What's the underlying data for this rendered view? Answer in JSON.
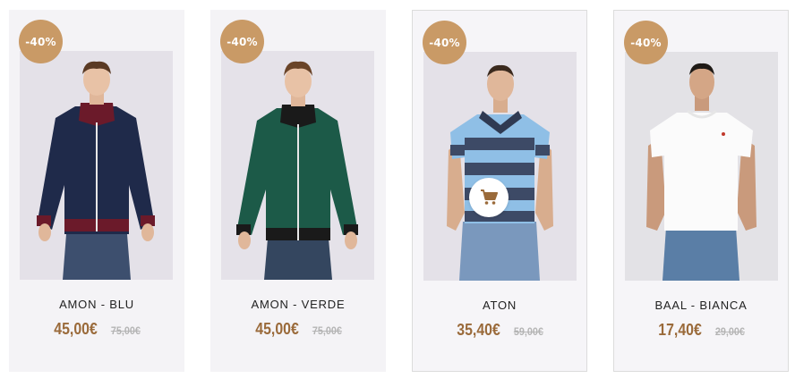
{
  "colors": {
    "badge": "#c99a66",
    "price": "#9a6a3a",
    "old_price": "#b4b4b4",
    "cart_icon": "#9a6a3a"
  },
  "products": [
    {
      "badge": "-40%",
      "name": "AMON - BLU",
      "price": "45,00€",
      "old_price": "75,00€",
      "jacket_color": "#1f2a4a",
      "collar_color": "#6b1a2a"
    },
    {
      "badge": "-40%",
      "name": "AMON - VERDE",
      "price": "45,00€",
      "old_price": "75,00€",
      "jacket_color": "#1c5a48",
      "collar_color": "#1a1a1a"
    },
    {
      "badge": "-40%",
      "name": "ATON",
      "price": "35,40€",
      "old_price": "59,00€",
      "shirt_color": "#8fbfe6",
      "stripe_color": "#3d4a66",
      "cart_icon": "cart-icon"
    },
    {
      "badge": "-40%",
      "name": "BAAL - BIANCA",
      "price": "17,40€",
      "old_price": "29,00€",
      "shirt_color": "#fbfbfb"
    }
  ]
}
